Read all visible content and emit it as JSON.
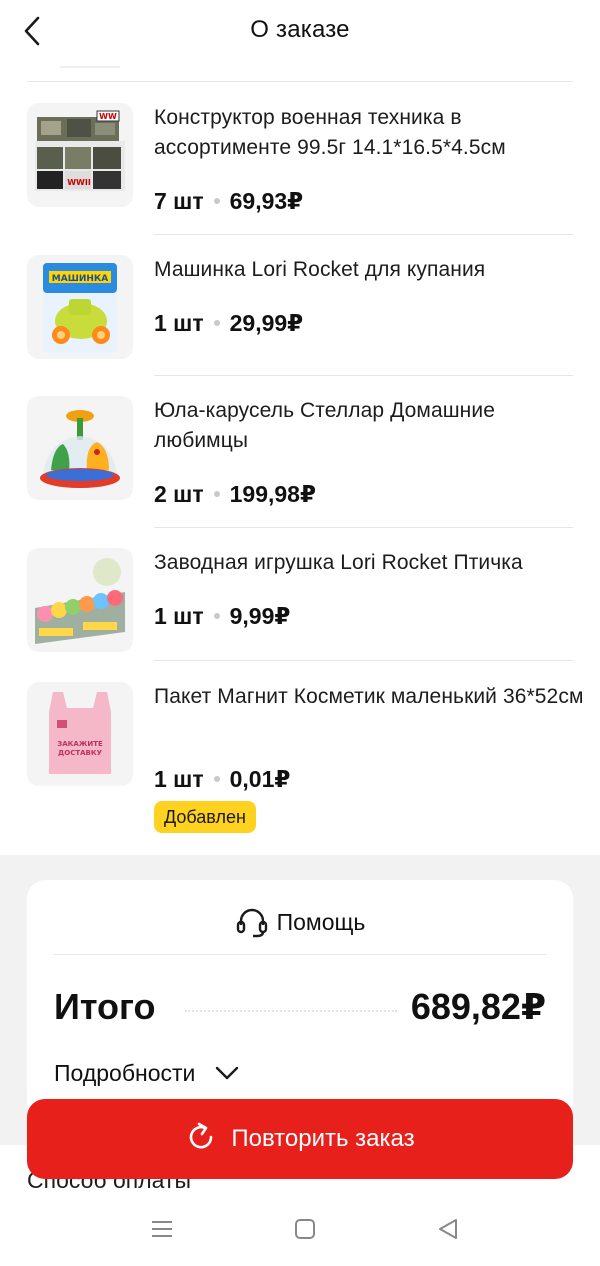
{
  "header": {
    "title": "О заказе",
    "back_icon": "chevron-left-icon"
  },
  "items": [
    {
      "name": "Конструктор военная техника в ассортименте 99.5г 14.1*16.5*4.5см",
      "qty": "7 шт",
      "price": "69,93₽",
      "image": "military-construction-set-box"
    },
    {
      "name": "Машинка Lori Rocket для купания",
      "qty": "1 шт",
      "price": "29,99₽",
      "image": "bath-toy-car-package"
    },
    {
      "name": "Юла-карусель Стеллар Домашние любимцы",
      "qty": "2 шт",
      "price": "199,98₽",
      "image": "spinning-top-carousel"
    },
    {
      "name": "Заводная игрушка Lori Rocket Птичка",
      "qty": "1 шт",
      "price": "9,99₽",
      "image": "wind-up-bird-toys-display"
    },
    {
      "name": "Пакет Магнит Косметик маленький 36*52см",
      "qty": "1 шт",
      "price": "0,01₽",
      "image": "pink-plastic-bag",
      "badge": "Добавлен"
    }
  ],
  "summary": {
    "help_label": "Помощь",
    "help_icon": "headset-icon",
    "total_label": "Итого",
    "total_value": "689,82₽",
    "details_label": "Подробности"
  },
  "actions": {
    "repeat_label": "Повторить заказ",
    "repeat_icon": "refresh-icon"
  },
  "payment_label": "Способ оплаты",
  "colors": {
    "accent_red": "#e8201c",
    "badge_yellow": "#ffd21f"
  }
}
